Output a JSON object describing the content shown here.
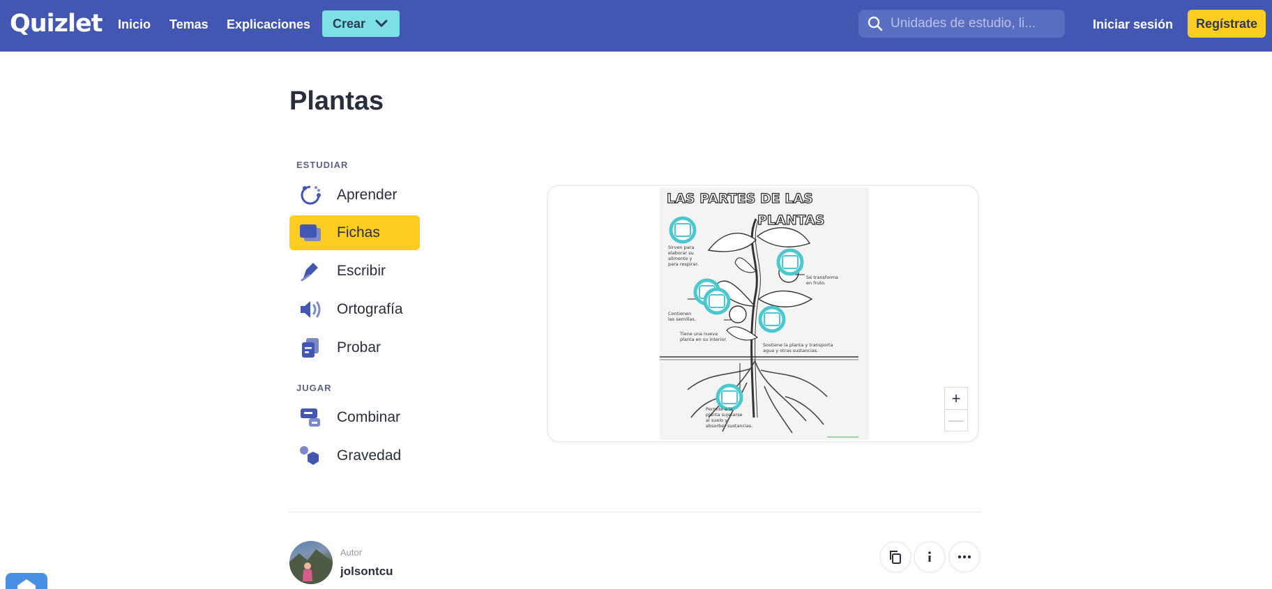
{
  "header": {
    "logo": "Quizlet",
    "nav": [
      "Inicio",
      "Temas",
      "Explicaciones"
    ],
    "create_label": "Crear",
    "search_placeholder": "Unidades de estudio, li...",
    "login_label": "Iniciar sesión",
    "signup_label": "Regístrate",
    "colors": {
      "bar": "#4257b2",
      "create": "#7de0e6",
      "signup": "#ffcd1f"
    }
  },
  "page": {
    "title": "Plantas"
  },
  "study": {
    "section_label": "ESTUDIAR",
    "modes": [
      {
        "label": "Aprender",
        "icon": "learn-icon"
      },
      {
        "label": "Fichas",
        "icon": "flashcards-icon",
        "active": true
      },
      {
        "label": "Escribir",
        "icon": "write-icon"
      },
      {
        "label": "Ortografía",
        "icon": "spell-icon"
      },
      {
        "label": "Probar",
        "icon": "test-icon"
      }
    ]
  },
  "play": {
    "section_label": "JUGAR",
    "modes": [
      {
        "label": "Combinar",
        "icon": "match-icon"
      },
      {
        "label": "Gravedad",
        "icon": "gravity-icon"
      }
    ]
  },
  "diagram": {
    "heading_line1": "LAS PARTES  DE LAS",
    "heading_line2": "PLANTAS",
    "labels": {
      "leaf": [
        "Sirven para",
        "elaborar su",
        "alimento y",
        "para respirar."
      ],
      "flower": [
        "Se transforma",
        "en fruto."
      ],
      "fruit": [
        "Contienen",
        "las semillas."
      ],
      "seed": [
        "Tiene una nueva",
        "planta en su interior."
      ],
      "stem": [
        "Sostiene la planta y transporta",
        "agua y otras sustancias."
      ],
      "root": [
        "Permite a la",
        "planta sujetarse",
        "al suelo y",
        "absorber sustancias."
      ]
    },
    "zoom_in": "+",
    "zoom_out": "—"
  },
  "author": {
    "label": "Autor",
    "name": "jolsontcu"
  }
}
